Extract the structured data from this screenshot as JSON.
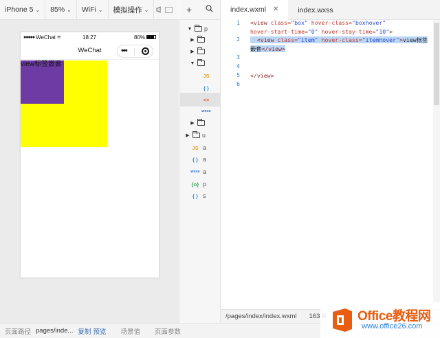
{
  "toolbar": {
    "device": "iPhone 5",
    "zoom": "85%",
    "network": "WiFi",
    "simulate": "模拟操作"
  },
  "phone": {
    "status": {
      "carrier": "WeChat",
      "time": "18:27",
      "battery": "80%"
    },
    "nav_title": "WeChat",
    "item_text": "view标签嵌套",
    "colors": {
      "box": "#ffff00",
      "item": "#6e3aa4"
    }
  },
  "tree": {
    "items": [
      {
        "name": "p",
        "type": "folder",
        "open": true
      },
      {
        "name": "",
        "type": "folder",
        "open": false
      },
      {
        "name": "",
        "type": "folder",
        "open": false
      },
      {
        "name": "",
        "type": "folder",
        "open": true
      },
      {
        "name": "",
        "type": "js"
      },
      {
        "name": "",
        "type": "json"
      },
      {
        "name": "",
        "type": "wxml",
        "selected": true
      },
      {
        "name": "",
        "type": "wxss"
      },
      {
        "name": "",
        "type": "folder",
        "open": false
      },
      {
        "name": "u",
        "type": "folder",
        "open": false
      },
      {
        "name": "a",
        "type": "js"
      },
      {
        "name": "a",
        "type": "json"
      },
      {
        "name": "a",
        "type": "wxss"
      },
      {
        "name": "p",
        "type": "sitemap"
      },
      {
        "name": "s",
        "type": "json"
      }
    ]
  },
  "editor": {
    "tabs": [
      {
        "label": "index.wxml",
        "active": true
      },
      {
        "label": "index.wxss",
        "active": false
      }
    ],
    "line_numbers": [
      "1",
      "2",
      "3",
      "4",
      "5",
      "6"
    ],
    "status_path": "/pages/index/index.wxml",
    "status_size": "163 B"
  },
  "bottom": {
    "path_label": "页面路径",
    "path_value": "pages/inde...",
    "copy": "复制",
    "preview": "预览",
    "scene": "场景值",
    "params": "页面参数"
  },
  "watermark": {
    "title": "Office教程网",
    "url": "www.office26.com"
  }
}
